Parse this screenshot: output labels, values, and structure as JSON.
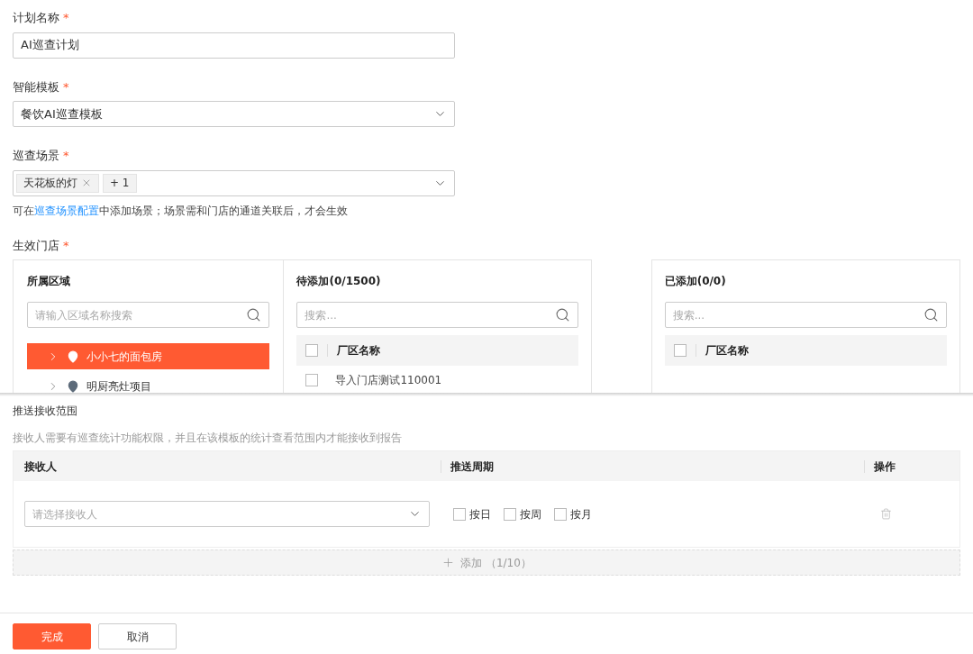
{
  "fields": [
    {
      "kind": "input",
      "label": "计划名称",
      "mark": "*",
      "value": "AI巡查计划"
    },
    {
      "kind": "select",
      "label": "智能模板",
      "mark": "*",
      "value": "餐饮AI巡查模板"
    },
    {
      "kind": "tags",
      "label": "巡查场景",
      "mark": "*",
      "tags": [
        "天花板的灯"
      ],
      "more": "+ 1",
      "hint": {
        "before": "可在",
        "link": "巡查场景配置",
        "after": "中添加场景；场景需和门店的通道关联后，才会生效"
      }
    }
  ],
  "stores": {
    "label": "生效门店",
    "mark": "*",
    "region": {
      "title": "所属区域",
      "placeholder": "请输入区域名称搜索",
      "items": [
        {
          "label": "小小七的面包房",
          "selected": true
        },
        {
          "label": "明厨亮灶项目",
          "selected": false
        }
      ]
    },
    "pending": {
      "title": "待添加(0/1500)",
      "placeholder": "搜索...",
      "column": "厂区名称",
      "all_checked": false,
      "rows": [
        {
          "label": "导入门店测试110001",
          "checked": false
        }
      ]
    },
    "added": {
      "title": "已添加(0/0)",
      "placeholder": "搜索...",
      "column": "厂区名称",
      "all_checked": false
    }
  },
  "push": {
    "title": "推送接收范围",
    "hint": "接收人需要有巡查统计功能权限，并且在该模板的统计查看范围内才能接收到报告",
    "columns": [
      "接收人",
      "推送周期",
      "操作"
    ],
    "rows": [
      {
        "placeholder": "请选择接收人",
        "periods": [
          {
            "label": "按日",
            "checked": false
          },
          {
            "label": "按周",
            "checked": false
          },
          {
            "label": "按月",
            "checked": false
          }
        ]
      }
    ],
    "add": "添加 （1/10）"
  },
  "buttons": [
    {
      "label": "完成",
      "kind": "primary"
    },
    {
      "label": "取消",
      "kind": "default"
    }
  ]
}
